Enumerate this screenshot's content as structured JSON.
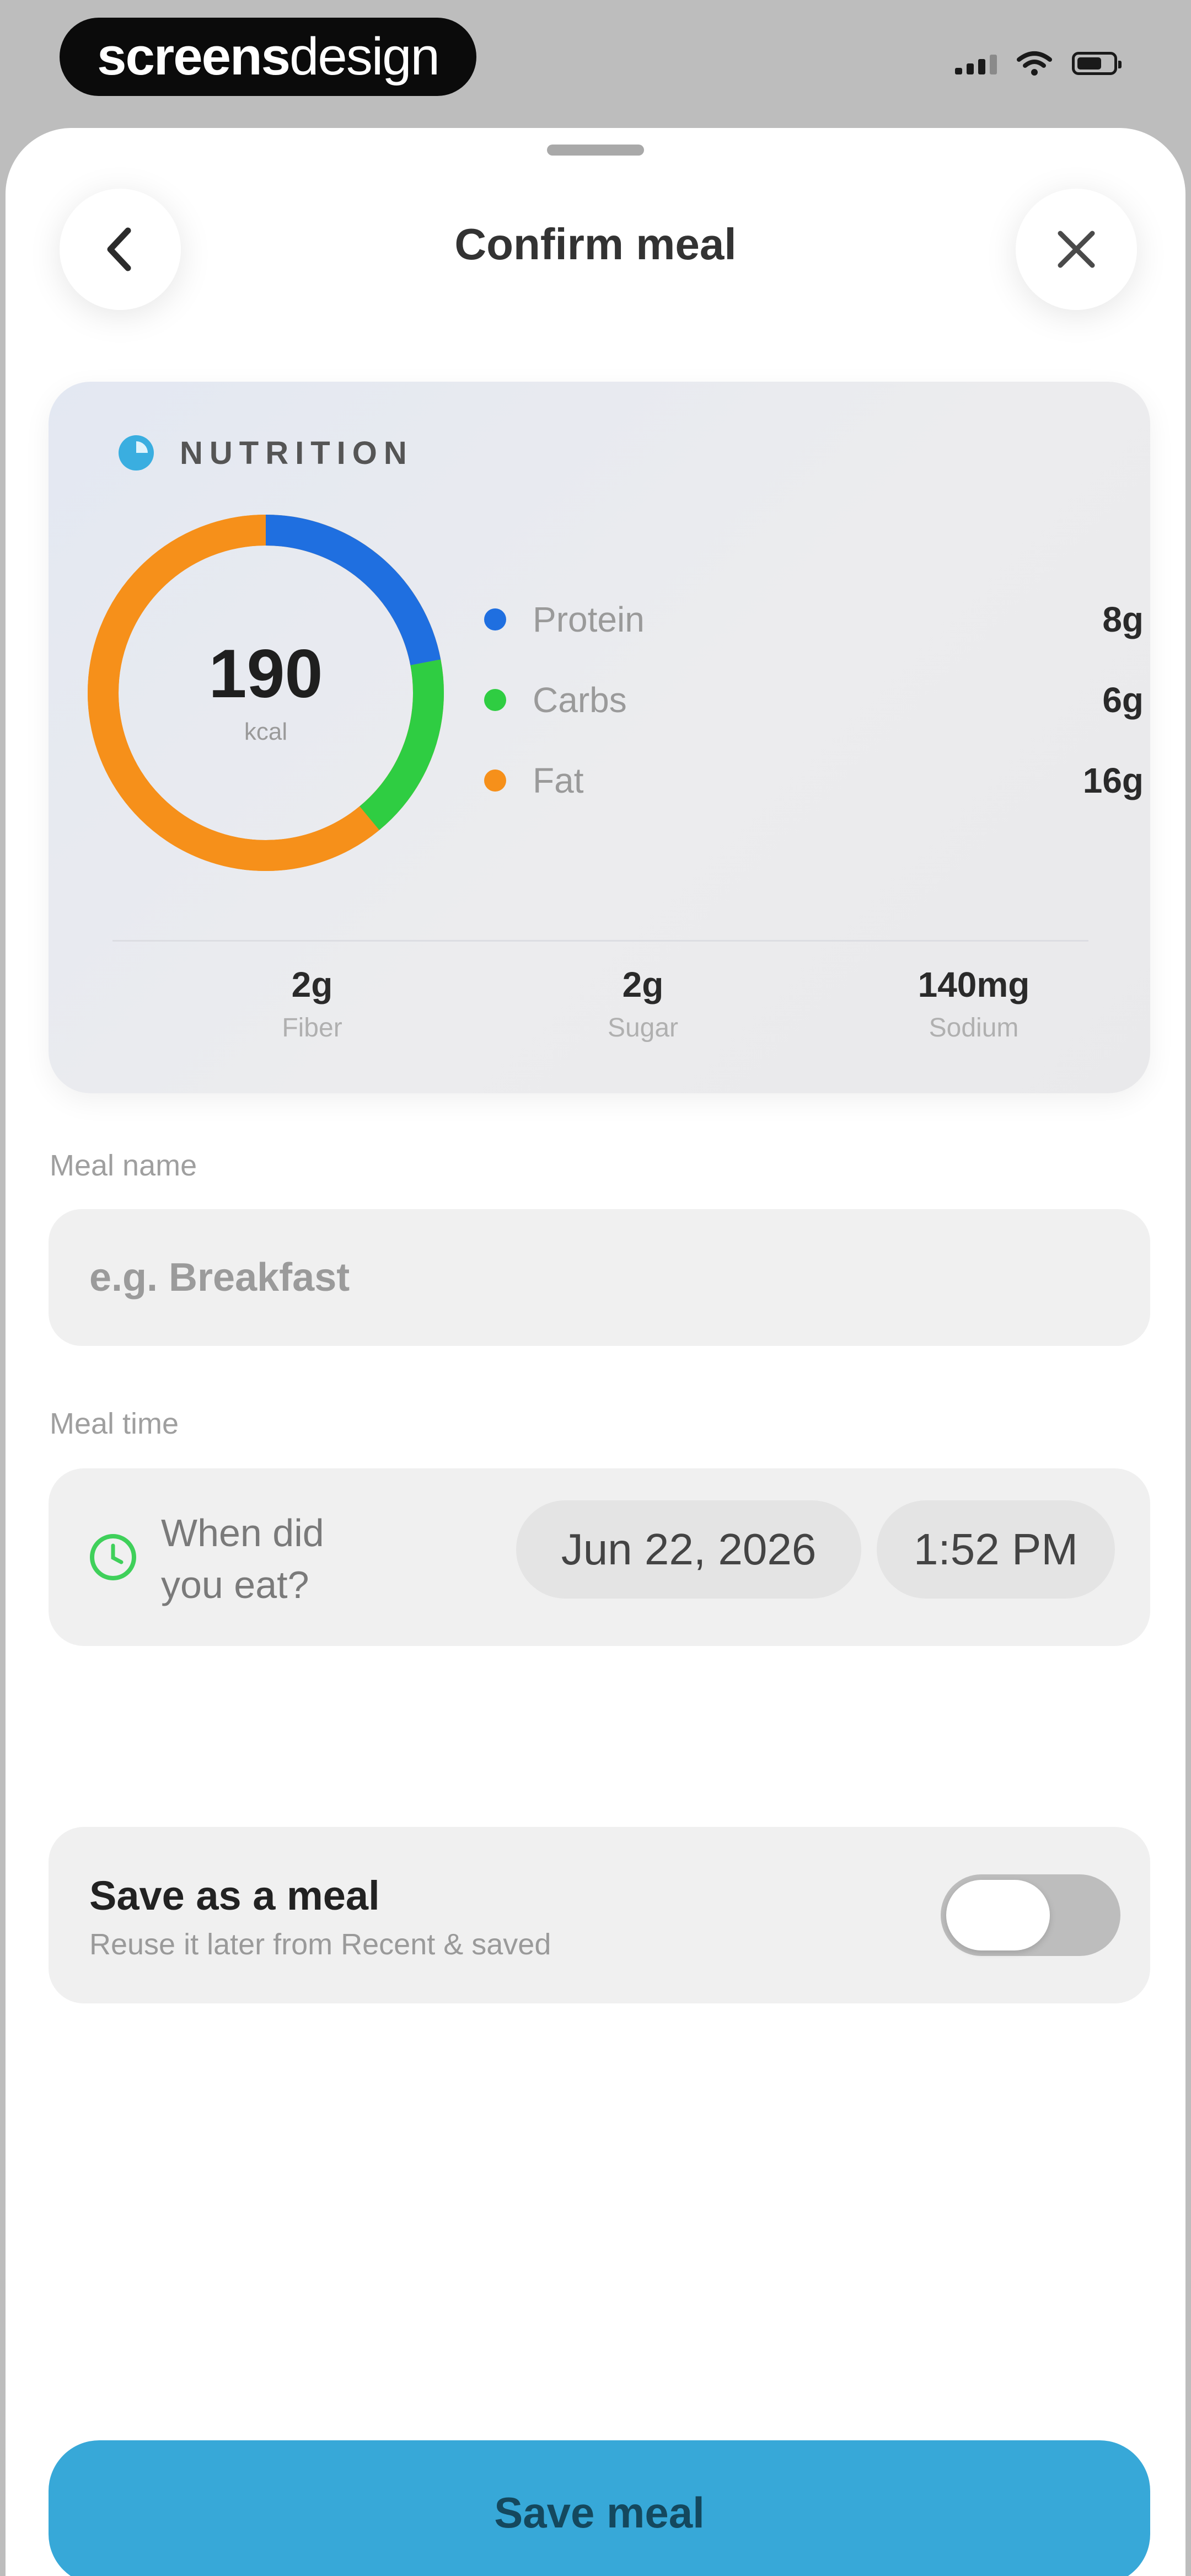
{
  "status_bar": {
    "brand_bold": "screens",
    "brand_light": "design",
    "icons": [
      "signal-icon",
      "wifi-icon",
      "battery-icon"
    ]
  },
  "header": {
    "title": "Confirm meal",
    "back_icon": "chevron-left-icon",
    "close_icon": "close-icon"
  },
  "nutrition": {
    "section_label": "NUTRITION",
    "calories": {
      "value": "190",
      "unit": "kcal"
    },
    "macros": [
      {
        "label": "Protein",
        "value": "8g",
        "color": "#1f6fe0"
      },
      {
        "label": "Carbs",
        "value": "6g",
        "color": "#2fcd42"
      },
      {
        "label": "Fat",
        "value": "16g",
        "color": "#f6901a"
      }
    ],
    "ring_shares": {
      "protein": 0.22,
      "carbs": 0.17,
      "fat": 0.61
    },
    "micros": [
      {
        "value": "2g",
        "label": "Fiber"
      },
      {
        "value": "2g",
        "label": "Sugar"
      },
      {
        "value": "140mg",
        "label": "Sodium"
      }
    ]
  },
  "meal_name": {
    "label": "Meal name",
    "placeholder": "e.g. Breakfast",
    "value": ""
  },
  "meal_time": {
    "label": "Meal time",
    "prompt": "When did you eat?",
    "date": "Jun 22, 2026",
    "time": "1:52 PM"
  },
  "save_as_meal": {
    "title": "Save as a meal",
    "subtitle": "Reuse it later from Recent & saved",
    "enabled": false
  },
  "actions": {
    "save_label": "Save meal"
  },
  "colors": {
    "accent": "#37a8d8",
    "protein": "#1f6fe0",
    "carbs": "#2fcd42",
    "fat": "#f6901a"
  }
}
